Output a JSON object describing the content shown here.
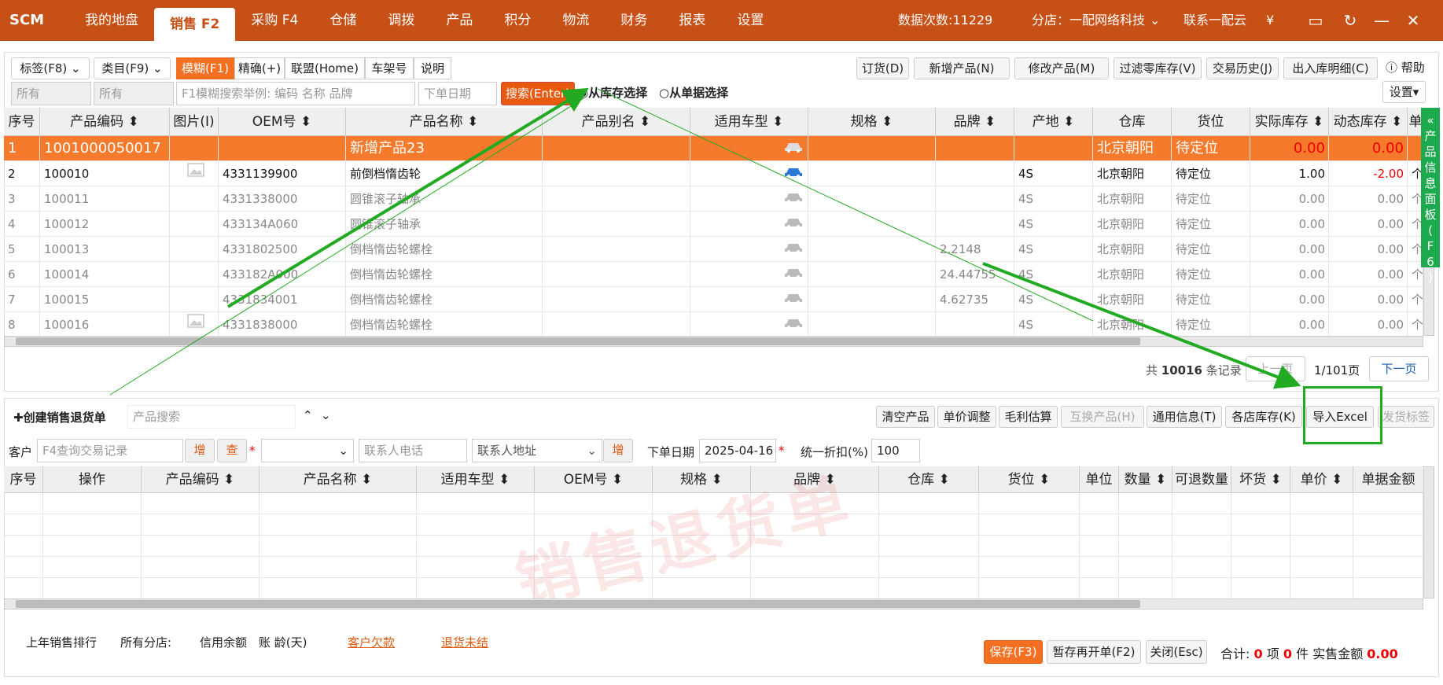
{
  "topbar": {
    "logo": "SCM",
    "tabs": [
      "我的地盘",
      "销售 F2",
      "采购 F4",
      "仓储",
      "调拨",
      "产品",
      "积分",
      "物流",
      "财务",
      "报表",
      "设置"
    ],
    "data_count": "数据次数:11229",
    "branch": "分店：一配网络科技（北",
    "contact": "联系一配云",
    "currency": "¥"
  },
  "toolbar": {
    "tag": "标签(F8)",
    "category": "类目(F9)",
    "modes": [
      "模糊(F1)",
      "精确(+)",
      "联盟(Home)",
      "车架号",
      "说明"
    ],
    "filter_all1": "所有",
    "filter_all2": "所有",
    "search_placeholder": "F1模糊搜索举例: 编码 名称 品牌",
    "date_placeholder": "下单日期",
    "search_btn": "搜索(Enter)",
    "radio_stock": "从库存选择",
    "radio_doc": "从单据选择",
    "actions": [
      "订货(D)",
      "新增产品(N)",
      "修改产品(M)",
      "过滤零库存(V)",
      "交易历史(J)",
      "出入库明细(C)"
    ],
    "help": "帮助",
    "settings": "设置"
  },
  "product_table": {
    "headers": [
      "序号",
      "产品编码",
      "图片(I)",
      "OEM号",
      "产品名称",
      "产品别名",
      "适用车型",
      "规格",
      "品牌",
      "产地",
      "仓库",
      "货位",
      "实际库存",
      "动态库存",
      "单"
    ],
    "rows": [
      {
        "no": "1",
        "code": "1001000050017",
        "img": false,
        "oem": "",
        "name": "新增产品23",
        "brand": "",
        "origin": "",
        "wh": "北京朝阳",
        "loc": "待定位",
        "stock": "0.00",
        "dyn": "0.00",
        "unit": ""
      },
      {
        "no": "2",
        "code": "100010",
        "img": true,
        "oem": "4331139900",
        "name": "前倒档惰齿轮",
        "brand": "",
        "origin": "4S",
        "wh": "北京朝阳",
        "loc": "待定位",
        "stock": "1.00",
        "dyn": "-2.00",
        "unit": "个"
      },
      {
        "no": "3",
        "code": "100011",
        "img": false,
        "oem": "4331338000",
        "name": "圆锥滚子轴承",
        "brand": "",
        "origin": "4S",
        "wh": "北京朝阳",
        "loc": "待定位",
        "stock": "0.00",
        "dyn": "0.00",
        "unit": "个"
      },
      {
        "no": "4",
        "code": "100012",
        "img": false,
        "oem": "433134A060",
        "name": "圆锥滚子轴承",
        "brand": "",
        "origin": "4S",
        "wh": "北京朝阳",
        "loc": "待定位",
        "stock": "0.00",
        "dyn": "0.00",
        "unit": "个"
      },
      {
        "no": "5",
        "code": "100013",
        "img": false,
        "oem": "4331802500",
        "name": "倒档惰齿轮螺栓",
        "brand": "2.2148",
        "origin": "4S",
        "wh": "北京朝阳",
        "loc": "待定位",
        "stock": "0.00",
        "dyn": "0.00",
        "unit": "个"
      },
      {
        "no": "6",
        "code": "100014",
        "img": false,
        "oem": "433182A000",
        "name": "倒档惰齿轮螺栓",
        "brand": "24.44755",
        "origin": "4S",
        "wh": "北京朝阳",
        "loc": "待定位",
        "stock": "0.00",
        "dyn": "0.00",
        "unit": "个"
      },
      {
        "no": "7",
        "code": "100015",
        "img": false,
        "oem": "4331834001",
        "name": "倒档惰齿轮螺栓",
        "brand": "4.62735",
        "origin": "4S",
        "wh": "北京朝阳",
        "loc": "待定位",
        "stock": "0.00",
        "dyn": "0.00",
        "unit": "个"
      },
      {
        "no": "8",
        "code": "100016",
        "img": true,
        "oem": "4331838000",
        "name": "倒档惰齿轮螺栓",
        "brand": "",
        "origin": "4S",
        "wh": "北京朝阳",
        "loc": "待定位",
        "stock": "0.00",
        "dyn": "0.00",
        "unit": "个"
      }
    ]
  },
  "side_panel": "产品信息面板(F6)",
  "pager": {
    "prefix": "共",
    "total": "10016",
    "suffix": "条记录",
    "prev": "上一页",
    "page": "1/101页",
    "next": "下一页"
  },
  "return_form": {
    "create": "创建销售退货单",
    "product_search": "产品搜索",
    "actions": [
      "清空产品",
      "单价调整",
      "毛利估算",
      "互换产品(H)",
      "通用信息(T)",
      "各店库存(K)",
      "导入Excel",
      "发货标签"
    ],
    "customer_label": "客户",
    "customer_placeholder": "F4查询交易记录",
    "add": "增",
    "query": "查",
    "phone_placeholder": "联系人电话",
    "address_placeholder": "联系人地址",
    "date_label": "下单日期",
    "date": "2025-04-16",
    "discount_label": "统一折扣(%)",
    "discount": "100"
  },
  "return_table": {
    "headers": [
      "序号",
      "操作",
      "产品编码",
      "产品名称",
      "适用车型",
      "OEM号",
      "规格",
      "品牌",
      "仓库",
      "货位",
      "单位",
      "数量",
      "可退数量",
      "坏货",
      "单价",
      "单据金额"
    ]
  },
  "watermark": "销售退货单",
  "footer": {
    "rank": "上年销售排行",
    "branches": "所有分店:",
    "credit": "信用余额",
    "aging": "账 龄(天)",
    "debt": "客户欠款",
    "unsettled": "退货未结",
    "save": "保存(F3)",
    "hold": "暂存再开单(F2)",
    "close": "关闭(Esc)",
    "total_label": "合计:",
    "items": "0",
    "items_unit": "项",
    "pieces": "0",
    "pieces_unit": "件",
    "amount_label": "实售金额",
    "amount": "0.00"
  }
}
